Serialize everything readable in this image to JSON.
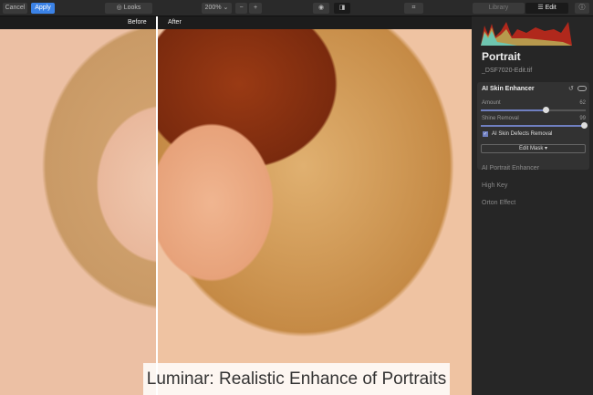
{
  "toolbar": {
    "cancel": "Cancel",
    "apply": "Apply",
    "looks": "Looks",
    "zoom": "200% ⌄",
    "minus": "−",
    "plus": "+",
    "library": "Library",
    "edit": "Edit"
  },
  "compare": {
    "before": "Before",
    "after": "After"
  },
  "caption": "Luminar: Realistic Enhance of Portraits",
  "panel": {
    "title": "Portrait",
    "filename": "_DSF7020-Edit.tif",
    "tool": {
      "name": "AI Skin Enhancer",
      "amount_label": "Amount",
      "amount": 62,
      "shine_label": "Shine Removal",
      "shine": 99,
      "defects_label": "AI Skin Defects Removal",
      "defects_checked": true,
      "edit_mask": "Edit Mask ▾"
    },
    "items": [
      "AI Portrait Enhancer",
      "High Key",
      "Orton Effect"
    ]
  },
  "colors": {
    "accent": "#3b82e6",
    "slider": "#6f7fc0"
  }
}
